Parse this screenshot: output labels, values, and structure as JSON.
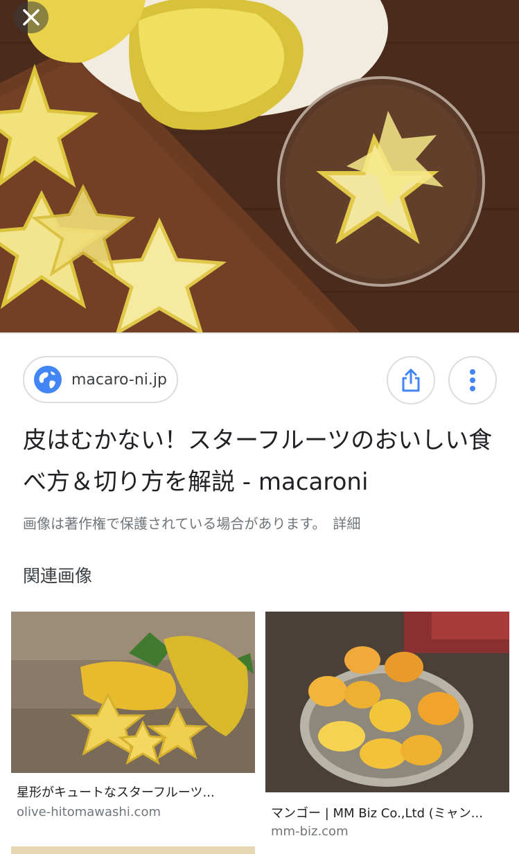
{
  "icons": {
    "close": "close-icon",
    "globe": "globe-icon",
    "share": "share-icon",
    "more": "more-vert-icon"
  },
  "colors": {
    "accent": "#4285f4",
    "border": "#dadce0",
    "muted_text": "#70757a"
  },
  "source": {
    "domain": "macaro-ni.jp"
  },
  "result": {
    "title": "皮はむかない！スターフルーツのおいしい食べ方＆切り方を解説 - macaroni",
    "copyright_notice": "画像は著作権で保護されている場合があります。",
    "details_link": "詳細"
  },
  "related": {
    "heading": "関連画像",
    "items": [
      {
        "caption": "星形がキュートなスターフルーツ...",
        "domain": "olive-hitomawashi.com"
      },
      {
        "caption": "マンゴー | MM Biz Co.,Ltd (ミャン...",
        "domain": "mm-biz.com"
      }
    ]
  }
}
